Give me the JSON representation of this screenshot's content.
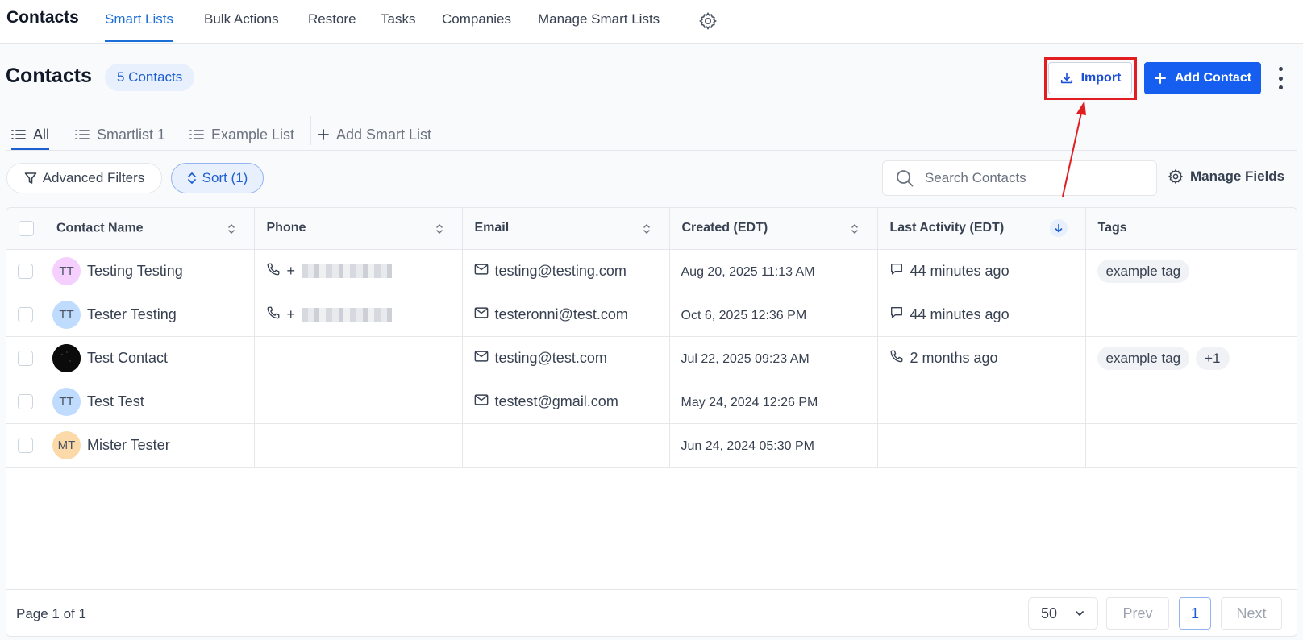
{
  "app": {
    "title": "Contacts"
  },
  "nav": {
    "tabs": [
      "Smart Lists",
      "Bulk Actions",
      "Restore",
      "Tasks",
      "Companies",
      "Manage Smart Lists"
    ],
    "active": "Smart Lists"
  },
  "header": {
    "title": "Contacts",
    "count_badge": "5 Contacts",
    "import_label": "Import",
    "add_contact_label": "Add Contact"
  },
  "smart_lists": {
    "tabs": [
      "All",
      "Smartlist 1",
      "Example List"
    ],
    "add_label": "Add Smart List",
    "active": "All"
  },
  "filters": {
    "advanced_filters_label": "Advanced Filters",
    "sort_label": "Sort (1)",
    "search_placeholder": "Search Contacts",
    "manage_fields_label": "Manage Fields"
  },
  "table": {
    "columns": [
      "Contact Name",
      "Phone",
      "Email",
      "Created (EDT)",
      "Last Activity (EDT)",
      "Tags"
    ],
    "rows": [
      {
        "initials": "TT",
        "avatar_color": "#f5d0fe",
        "name": "Testing Testing",
        "phone_prefix": "+",
        "phone_redacted": true,
        "email": "testing@testing.com",
        "created": "Aug 20, 2025 11:13 AM",
        "activity_icon": "chat-icon",
        "activity": "44 minutes ago",
        "tags": [
          "example tag"
        ]
      },
      {
        "initials": "TT",
        "avatar_color": "#bfdbfe",
        "name": "Tester Testing",
        "phone_prefix": "+",
        "phone_redacted": true,
        "email": "testeronni@test.com",
        "created": "Oct 6, 2025 12:36 PM",
        "activity_icon": "chat-icon",
        "activity": "44 minutes ago",
        "tags": []
      },
      {
        "initials": "",
        "avatar_color": "#0b0b0b",
        "name": "Test Contact",
        "phone_prefix": "",
        "phone_redacted": false,
        "email": "testing@test.com",
        "created": "Jul 22, 2025 09:23 AM",
        "activity_icon": "phone-icon",
        "activity": "2 months ago",
        "tags": [
          "example tag",
          "+1"
        ]
      },
      {
        "initials": "TT",
        "avatar_color": "#bfdbfe",
        "name": "Test Test",
        "phone_prefix": "",
        "phone_redacted": false,
        "email": "testest@gmail.com",
        "created": "May 24, 2024 12:26 PM",
        "activity_icon": "",
        "activity": "",
        "tags": []
      },
      {
        "initials": "MT",
        "avatar_color": "#fcd9a8",
        "name": "Mister Tester",
        "phone_prefix": "",
        "phone_redacted": false,
        "email": "",
        "created": "Jun 24, 2024 05:30 PM",
        "activity_icon": "",
        "activity": "",
        "tags": []
      }
    ]
  },
  "footer": {
    "page_info": "Page 1 of 1",
    "per_page": "50",
    "prev_label": "Prev",
    "current_page": "1",
    "next_label": "Next"
  },
  "colors": {
    "accent": "#155eef",
    "annotation": "#e11d21"
  }
}
